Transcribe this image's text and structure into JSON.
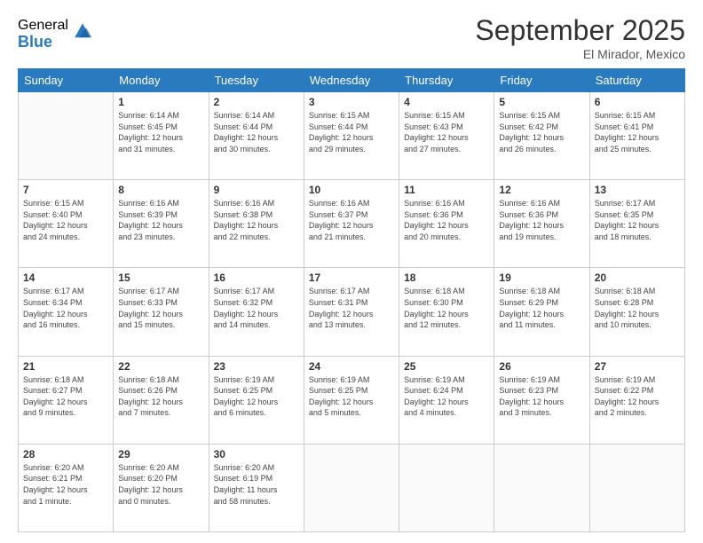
{
  "logo": {
    "general": "General",
    "blue": "Blue"
  },
  "header": {
    "month": "September 2025",
    "location": "El Mirador, Mexico"
  },
  "days_of_week": [
    "Sunday",
    "Monday",
    "Tuesday",
    "Wednesday",
    "Thursday",
    "Friday",
    "Saturday"
  ],
  "weeks": [
    [
      {
        "day": "",
        "info": ""
      },
      {
        "day": "1",
        "info": "Sunrise: 6:14 AM\nSunset: 6:45 PM\nDaylight: 12 hours\nand 31 minutes."
      },
      {
        "day": "2",
        "info": "Sunrise: 6:14 AM\nSunset: 6:44 PM\nDaylight: 12 hours\nand 30 minutes."
      },
      {
        "day": "3",
        "info": "Sunrise: 6:15 AM\nSunset: 6:44 PM\nDaylight: 12 hours\nand 29 minutes."
      },
      {
        "day": "4",
        "info": "Sunrise: 6:15 AM\nSunset: 6:43 PM\nDaylight: 12 hours\nand 27 minutes."
      },
      {
        "day": "5",
        "info": "Sunrise: 6:15 AM\nSunset: 6:42 PM\nDaylight: 12 hours\nand 26 minutes."
      },
      {
        "day": "6",
        "info": "Sunrise: 6:15 AM\nSunset: 6:41 PM\nDaylight: 12 hours\nand 25 minutes."
      }
    ],
    [
      {
        "day": "7",
        "info": "Sunrise: 6:15 AM\nSunset: 6:40 PM\nDaylight: 12 hours\nand 24 minutes."
      },
      {
        "day": "8",
        "info": "Sunrise: 6:16 AM\nSunset: 6:39 PM\nDaylight: 12 hours\nand 23 minutes."
      },
      {
        "day": "9",
        "info": "Sunrise: 6:16 AM\nSunset: 6:38 PM\nDaylight: 12 hours\nand 22 minutes."
      },
      {
        "day": "10",
        "info": "Sunrise: 6:16 AM\nSunset: 6:37 PM\nDaylight: 12 hours\nand 21 minutes."
      },
      {
        "day": "11",
        "info": "Sunrise: 6:16 AM\nSunset: 6:36 PM\nDaylight: 12 hours\nand 20 minutes."
      },
      {
        "day": "12",
        "info": "Sunrise: 6:16 AM\nSunset: 6:36 PM\nDaylight: 12 hours\nand 19 minutes."
      },
      {
        "day": "13",
        "info": "Sunrise: 6:17 AM\nSunset: 6:35 PM\nDaylight: 12 hours\nand 18 minutes."
      }
    ],
    [
      {
        "day": "14",
        "info": "Sunrise: 6:17 AM\nSunset: 6:34 PM\nDaylight: 12 hours\nand 16 minutes."
      },
      {
        "day": "15",
        "info": "Sunrise: 6:17 AM\nSunset: 6:33 PM\nDaylight: 12 hours\nand 15 minutes."
      },
      {
        "day": "16",
        "info": "Sunrise: 6:17 AM\nSunset: 6:32 PM\nDaylight: 12 hours\nand 14 minutes."
      },
      {
        "day": "17",
        "info": "Sunrise: 6:17 AM\nSunset: 6:31 PM\nDaylight: 12 hours\nand 13 minutes."
      },
      {
        "day": "18",
        "info": "Sunrise: 6:18 AM\nSunset: 6:30 PM\nDaylight: 12 hours\nand 12 minutes."
      },
      {
        "day": "19",
        "info": "Sunrise: 6:18 AM\nSunset: 6:29 PM\nDaylight: 12 hours\nand 11 minutes."
      },
      {
        "day": "20",
        "info": "Sunrise: 6:18 AM\nSunset: 6:28 PM\nDaylight: 12 hours\nand 10 minutes."
      }
    ],
    [
      {
        "day": "21",
        "info": "Sunrise: 6:18 AM\nSunset: 6:27 PM\nDaylight: 12 hours\nand 9 minutes."
      },
      {
        "day": "22",
        "info": "Sunrise: 6:18 AM\nSunset: 6:26 PM\nDaylight: 12 hours\nand 7 minutes."
      },
      {
        "day": "23",
        "info": "Sunrise: 6:19 AM\nSunset: 6:25 PM\nDaylight: 12 hours\nand 6 minutes."
      },
      {
        "day": "24",
        "info": "Sunrise: 6:19 AM\nSunset: 6:25 PM\nDaylight: 12 hours\nand 5 minutes."
      },
      {
        "day": "25",
        "info": "Sunrise: 6:19 AM\nSunset: 6:24 PM\nDaylight: 12 hours\nand 4 minutes."
      },
      {
        "day": "26",
        "info": "Sunrise: 6:19 AM\nSunset: 6:23 PM\nDaylight: 12 hours\nand 3 minutes."
      },
      {
        "day": "27",
        "info": "Sunrise: 6:19 AM\nSunset: 6:22 PM\nDaylight: 12 hours\nand 2 minutes."
      }
    ],
    [
      {
        "day": "28",
        "info": "Sunrise: 6:20 AM\nSunset: 6:21 PM\nDaylight: 12 hours\nand 1 minute."
      },
      {
        "day": "29",
        "info": "Sunrise: 6:20 AM\nSunset: 6:20 PM\nDaylight: 12 hours\nand 0 minutes."
      },
      {
        "day": "30",
        "info": "Sunrise: 6:20 AM\nSunset: 6:19 PM\nDaylight: 11 hours\nand 58 minutes."
      },
      {
        "day": "",
        "info": ""
      },
      {
        "day": "",
        "info": ""
      },
      {
        "day": "",
        "info": ""
      },
      {
        "day": "",
        "info": ""
      }
    ]
  ]
}
